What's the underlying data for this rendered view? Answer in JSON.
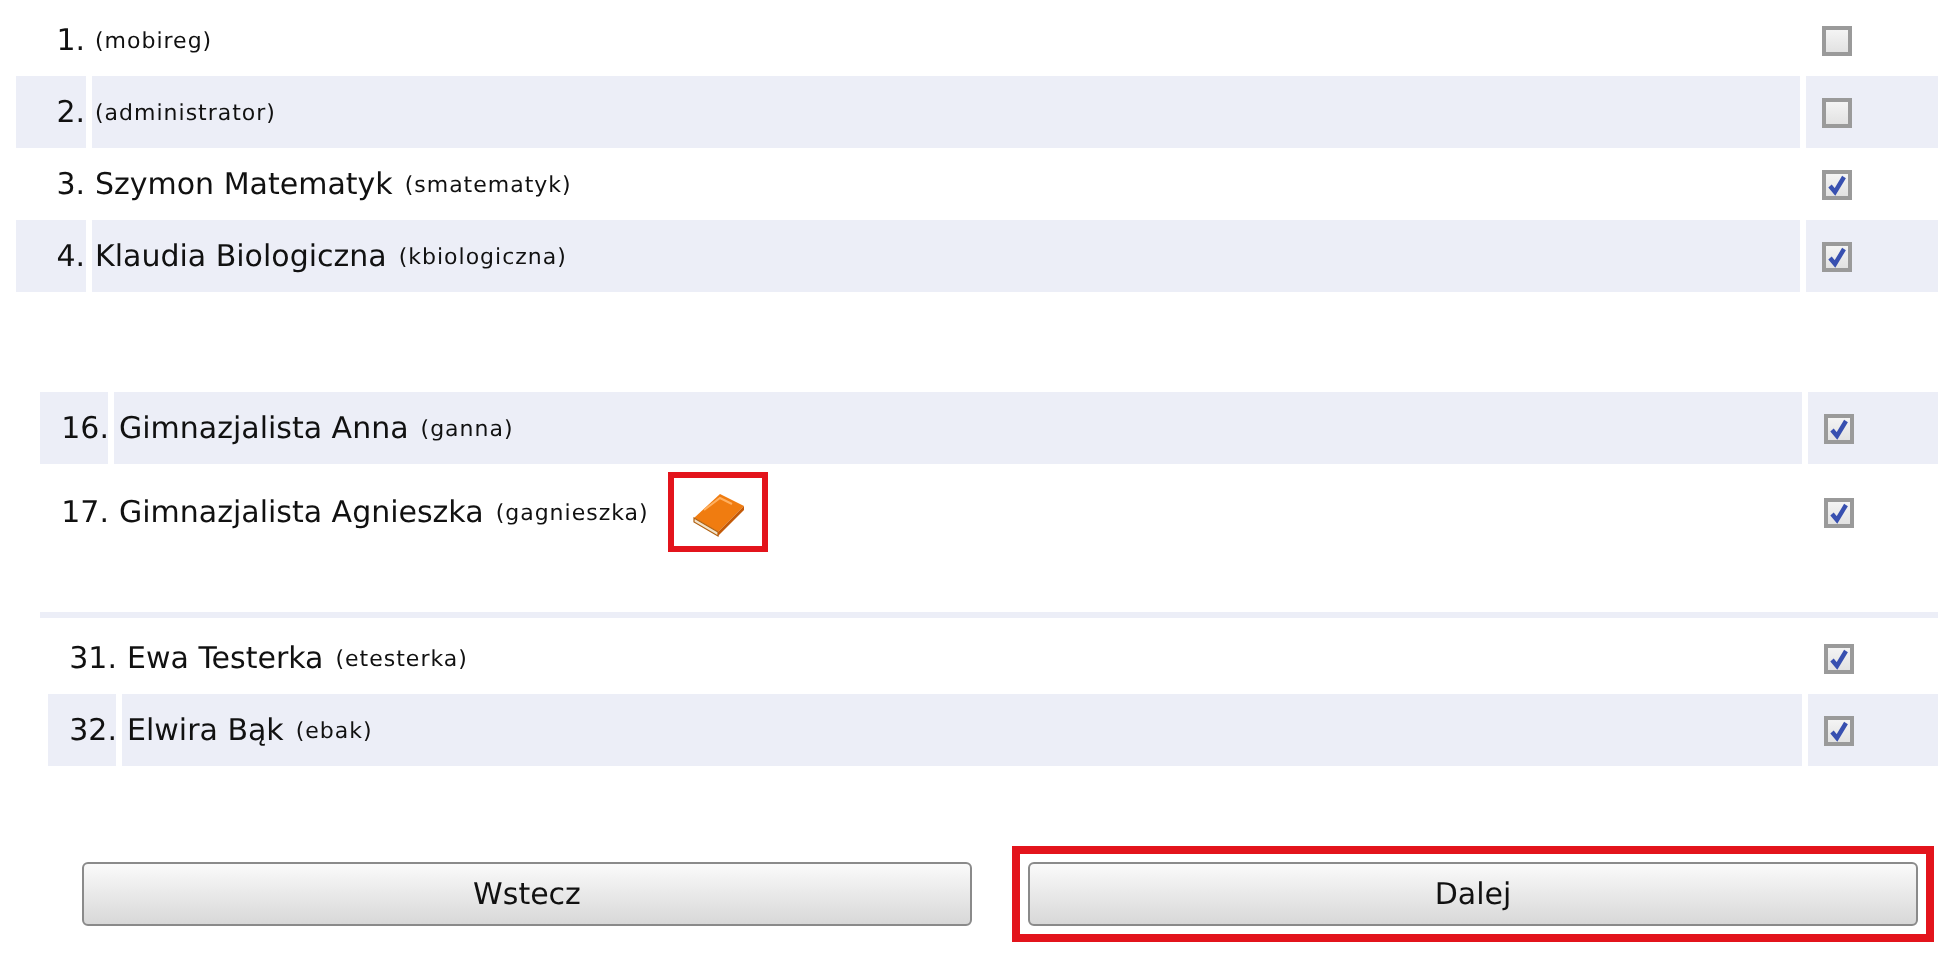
{
  "sections": [
    {
      "rows": [
        {
          "number": "1.",
          "login": "(mobireg)",
          "checked": false
        },
        {
          "number": "2.",
          "login": "(administrator)",
          "checked": false
        },
        {
          "number": "3.",
          "name": "Szymon Matematyk",
          "login": "(smatematyk)",
          "checked": true
        },
        {
          "number": "4.",
          "name": "Klaudia Biologiczna",
          "login": "(kbiologiczna)",
          "checked": true
        }
      ]
    },
    {
      "rows": [
        {
          "number": "16.",
          "name": "Gimnazjalista Anna",
          "login": "(ganna)",
          "checked": true
        },
        {
          "number": "17.",
          "name": "Gimnazjalista Agnieszka",
          "login": "(gagnieszka)",
          "checked": true,
          "book_highlighted": true
        }
      ]
    },
    {
      "rows": [
        {
          "number": "31.",
          "name": "Ewa Testerka",
          "login": "(etesterka)",
          "checked": true
        },
        {
          "number": "32.",
          "name": "Elwira Bąk",
          "login": "(ebak)",
          "checked": true
        }
      ]
    }
  ],
  "buttons": [
    {
      "label": "Wstecz",
      "highlighted": false
    },
    {
      "label": "Dalej",
      "highlighted": true
    }
  ]
}
